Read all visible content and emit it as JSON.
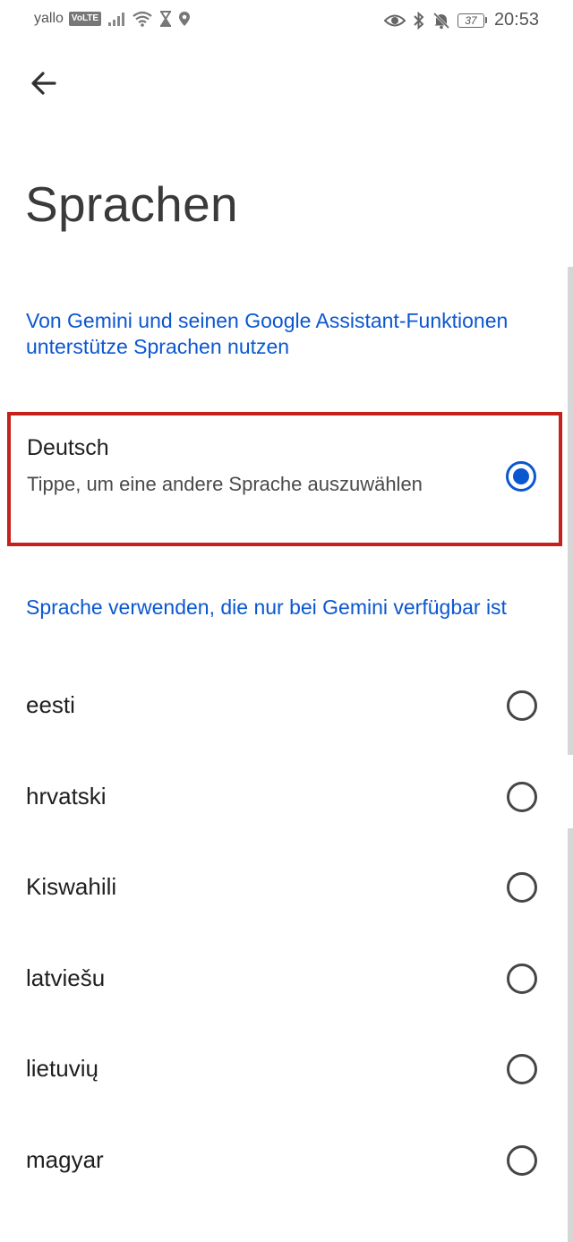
{
  "status_bar": {
    "carrier": "yallo",
    "volte": "VoLTE",
    "battery": "37",
    "time": "20:53"
  },
  "header": {
    "back_icon": "arrow-back-icon",
    "title": "Sprachen"
  },
  "section_assistant": {
    "link": "Von Gemini und seinen Google Assistant-Funktionen unterstütze Sprachen nutzen",
    "selected": {
      "title": "Deutsch",
      "subtitle": "Tippe, um eine andere Sprache auszuwählen",
      "checked": true
    }
  },
  "section_gemini_only": {
    "link": "Sprache verwenden, die nur bei Gemini verfügbar ist",
    "languages": [
      "eesti",
      "hrvatski",
      "Kiswahili",
      "latviešu",
      "lietuvių",
      "magyar"
    ]
  },
  "colors": {
    "accent": "#0b57d0",
    "highlight_border": "#c4201c"
  }
}
